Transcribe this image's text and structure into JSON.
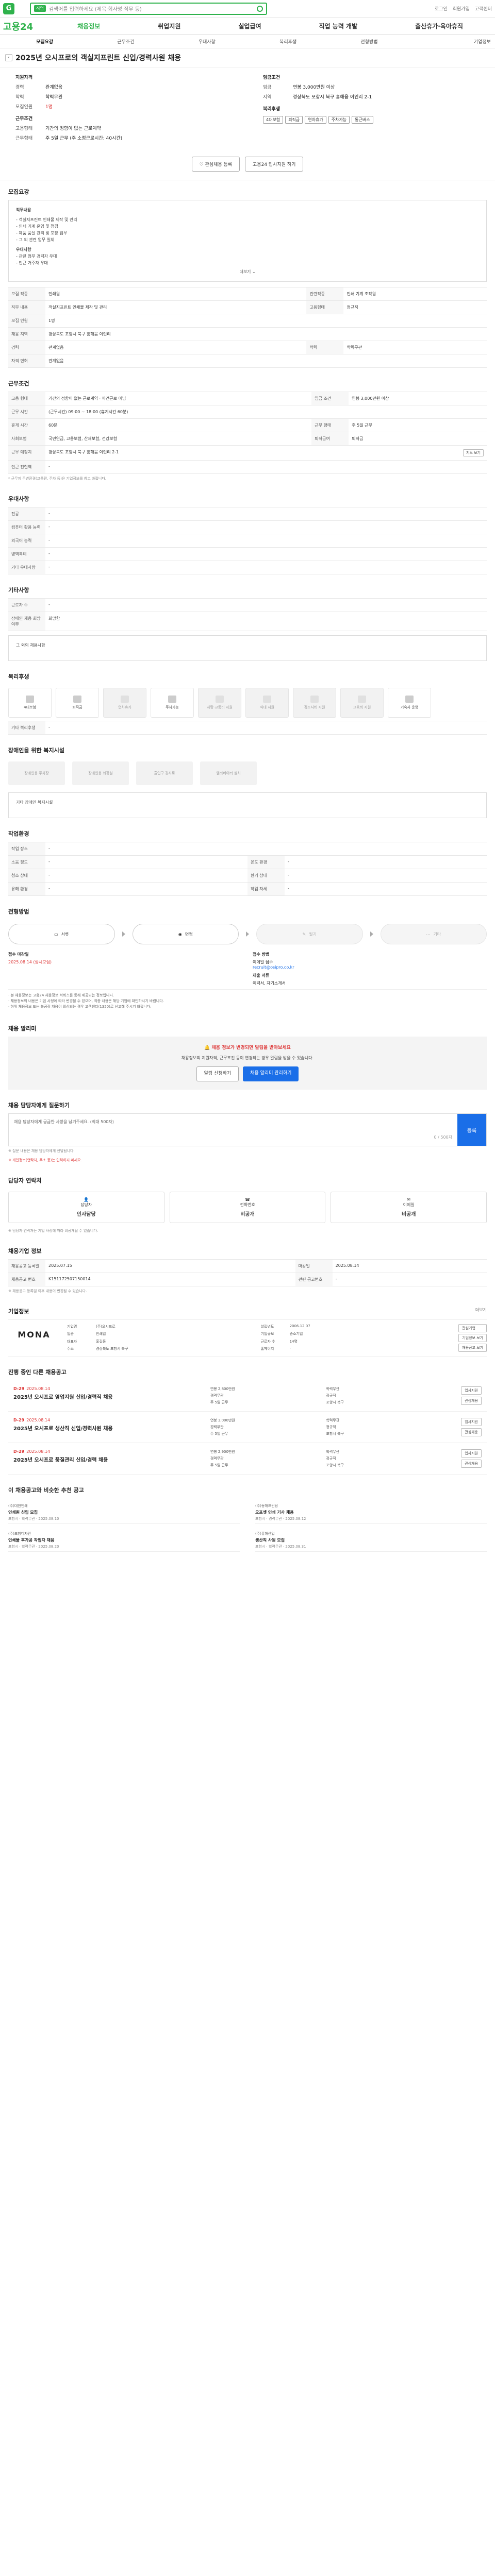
{
  "header": {
    "logo_char": "G",
    "search_mode": "직업",
    "search_placeholder": "검색어를 입력하세요 (제목·회사명·직무 등)",
    "util_links": [
      "로그인",
      "회원가입",
      "고객센터"
    ]
  },
  "gnb": {
    "brand": "고용24",
    "menu": [
      "채용정보",
      "취업지원",
      "실업급여",
      "직업 능력 개발",
      "출산휴가·육아휴직"
    ]
  },
  "tabs": [
    "모집요강",
    "근무조건",
    "우대사항",
    "복리후생",
    "전형방법",
    "기업정보"
  ],
  "page_title": "2025년 오시프로의 객실지프린트 신입/경력사원 채용",
  "summary": {
    "left": {
      "heading": "지원자격",
      "rows": [
        {
          "k": "경력",
          "v": "관계없음"
        },
        {
          "k": "학력",
          "v": "학력무관"
        },
        {
          "k": "모집인원",
          "v": "1명"
        }
      ],
      "heading2": "근무조건",
      "rows2": [
        {
          "k": "고용형태",
          "v": "기간의 정함이 없는 근로계약"
        },
        {
          "k": "근무형태",
          "v": "주 5일 근무 (주 소정근로시간: 40시간)"
        }
      ]
    },
    "right": {
      "heading": "임금조건",
      "rows": [
        {
          "k": "임금",
          "v": "연봉 3,000만원 이상"
        },
        {
          "k": "지역",
          "v": "경상북도 포항시 북구 흥해읍 이인리 2-1"
        }
      ],
      "heading2": "복리후생",
      "chips": [
        "4대보험",
        "퇴직금",
        "연차휴가",
        "주차가능",
        "통근버스"
      ]
    }
  },
  "actions": {
    "bookmark": "관심채용 등록",
    "apply": "고용24 입사지원 하기"
  },
  "sections": {
    "recruit": {
      "title": "모집요강",
      "desc": [
        "직무내용",
        "- 객실지프린트 인쇄물 제작 및 관리",
        "- 인쇄 기계 운영 및 점검",
        "- 제품 품질 관리 및 포장 업무",
        "- 그 외 관련 업무 일체",
        "우대사항",
        "- 관련 업무 경력자 우대",
        "- 인근 거주자 우대"
      ],
      "more": "더보기",
      "table": [
        {
          "k": "모집 직종",
          "v": "인쇄원",
          "k2": "관련직종",
          "v2": "인쇄 기계 조작원"
        },
        {
          "k": "직무 내용",
          "v": "객실지프린트 인쇄물 제작 및 관리",
          "k2": "고용형태",
          "v2": "정규직"
        },
        {
          "k": "모집 인원",
          "v": "1명",
          "k2": "",
          "v2": ""
        },
        {
          "k": "채용 지역",
          "v": "경상북도 포항시 북구 흥해읍 이인리",
          "k2": "",
          "v2": ""
        },
        {
          "k": "경력",
          "v": "관계없음",
          "k2": "학력",
          "v2": "학력무관"
        },
        {
          "k": "자격 면허",
          "v": "관계없음",
          "k2": "",
          "v2": ""
        }
      ]
    },
    "conditions": {
      "title": "근무조건",
      "table": [
        {
          "k": "고용 형태",
          "v": "기간의 정함이 없는 근로계약 · 파견근로 아님",
          "k2": "임금 조건",
          "v2": "연봉 3,000만원 이상"
        },
        {
          "k": "근무 시간",
          "v": "(근무시간) 09:00 ~ 18:00 (휴게시간 60분)",
          "k2": "",
          "v2": ""
        },
        {
          "k": "휴게 시간",
          "v": "60분",
          "k2": "근무 형태",
          "v2": "주 5일 근무"
        },
        {
          "k": "사회보험",
          "v": "국민연금, 고용보험, 산재보험, 건강보험",
          "k2": "퇴직급여",
          "v2": "퇴직금"
        },
        {
          "k": "근무 예정지",
          "v": "경상북도 포항시 북구 흥해읍 이인리 2-1",
          "k2": "",
          "v2": ""
        },
        {
          "k": "인근 전철역",
          "v": "-",
          "k2": "",
          "v2": ""
        }
      ],
      "note": "* 근무지 주변환경(교통편, 주차 등)은 기업정보를 참고 바랍니다.",
      "map_btn": "지도 보기"
    },
    "prefer": {
      "title": "우대사항",
      "table": [
        {
          "k": "전공",
          "v": "-"
        },
        {
          "k": "컴퓨터 활용 능력",
          "v": "-"
        },
        {
          "k": "외국어 능력",
          "v": "-"
        },
        {
          "k": "병역특례",
          "v": "-"
        },
        {
          "k": "기타 우대사항",
          "v": "-"
        }
      ]
    },
    "extra": {
      "title": "기타사항",
      "table": [
        {
          "k": "근로자 수",
          "v": "-"
        },
        {
          "k": "장애인 채용 희망 여부",
          "v": "희망함"
        }
      ],
      "etc": "그 외의 채용사항"
    },
    "welfare": {
      "title": "복리후생",
      "items": [
        {
          "label": "4대보험",
          "dim": false
        },
        {
          "label": "퇴직금",
          "dim": false
        },
        {
          "label": "연차휴가",
          "dim": true
        },
        {
          "label": "주차가능",
          "dim": false
        },
        {
          "label": "차량·교통비 지원",
          "dim": true
        },
        {
          "label": "식대 지원",
          "dim": true
        },
        {
          "label": "경조사비 지원",
          "dim": true
        },
        {
          "label": "교육비 지원",
          "dim": true
        },
        {
          "label": "기숙사 운영",
          "dim": false
        }
      ],
      "etc_label": "기타 복리후생",
      "etc_value": "-"
    },
    "disability": {
      "title": "장애인을 위한 복지시설",
      "items": [
        "장애인용 주차장",
        "장애인용 화장실",
        "출입구 경사로",
        "엘리베이터 설치"
      ],
      "etc": "기타 장애인 복지시설"
    },
    "worktype": {
      "title": "작업환경",
      "table": [
        {
          "k": "작업 장소",
          "v": "-",
          "k2": "",
          "v2": ""
        },
        {
          "k": "소음 정도",
          "v": "-",
          "k2": "온도 환경",
          "v2": "-"
        },
        {
          "k": "청소 상태",
          "v": "-",
          "k2": "환기 상태",
          "v2": "-"
        },
        {
          "k": "유해 환경",
          "v": "-",
          "k2": "작업 자세",
          "v2": "-"
        }
      ]
    },
    "process": {
      "title": "전형방법",
      "steps": [
        {
          "label": "서류",
          "dim": false
        },
        {
          "label": "면접",
          "dim": false
        },
        {
          "label": "필기",
          "dim": true
        },
        {
          "label": "기타",
          "dim": true
        }
      ]
    },
    "apply": {
      "period_label": "접수 마감일",
      "period": "2025.08.14 (상시모집)",
      "method_label": "접수 방법",
      "method": "이메일 접수",
      "email": "recruit@osipro.co.kr",
      "docs_label": "제출 서류",
      "docs": "이력서, 자기소개서",
      "bullets": [
        "· 본 채용정보는 고용24 채용정보 서비스를 통해 제공되는 정보입니다.",
        "· 채용정보의 내용은 기업 사정에 따라 변경될 수 있으며, 최종 내용은 해당 기업에 확인하시기 바랍니다.",
        "· 허위 채용정보 또는 불공정 채용이 의심되는 경우 고객센터(1350)로 신고해 주시기 바랍니다."
      ]
    },
    "report": {
      "title": "채용 알리미",
      "alert_title": "채용 정보가 변경되면 알림을 받아보세요",
      "alert_body": "채용정보의 지원자격, 근무조건 등이 변경되는 경우 알림을 받을 수 있습니다.",
      "alert_btn1": "알림 신청하기",
      "alert_btn2": "채용 알리미 관리하기"
    },
    "inquiry": {
      "title": "채용 담당자에게 질문하기",
      "placeholder": "채용 담당자에게 궁금한 사항을 남겨주세요. (최대 500자)",
      "submit": "등록",
      "counter": "0 / 500자",
      "note1": "※ 질문 내용은 채용 담당자에게 전달됩니다.",
      "note2": "※ 개인정보(연락처, 주소 등)는 입력하지 마세요."
    },
    "contact": {
      "title": "담당자 연락처",
      "cards": [
        {
          "label": "담당자",
          "value": "인사담당"
        },
        {
          "label": "전화번호",
          "value": "비공개"
        },
        {
          "label": "이메일",
          "value": "비공개"
        }
      ],
      "note": "※ 담당자 연락처는 기업 사정에 따라 비공개될 수 있습니다."
    },
    "info": {
      "title": "채용기업 정보",
      "table": [
        {
          "k": "채용공고 등록일",
          "v": "2025.07.15",
          "k2": "마감일",
          "v2": "2025.08.14"
        },
        {
          "k": "채용공고 번호",
          "v": "K151172507150014",
          "k2": "관련 공고번호",
          "v2": "-"
        }
      ],
      "note": "※ 채용공고 등록일 이후 내용이 변경될 수 있습니다."
    },
    "company": {
      "title": "기업정보",
      "more": "더보기",
      "logo": "MONA",
      "fields": [
        {
          "k": "기업명",
          "v": "(주)오시프로"
        },
        {
          "k": "설립년도",
          "v": "2006.12.07"
        },
        {
          "k": "업종",
          "v": "인쇄업"
        },
        {
          "k": "기업규모",
          "v": "중소기업"
        },
        {
          "k": "대표자",
          "v": "홍길동"
        },
        {
          "k": "근로자 수",
          "v": "14명"
        },
        {
          "k": "주소",
          "v": "경상북도 포항시 북구"
        },
        {
          "k": "홈페이지",
          "v": "-"
        }
      ],
      "btns": [
        "관심기업",
        "기업정보 보기",
        "채용공고 보기"
      ]
    },
    "jobs": {
      "title": "진행 중인 다른 채용공고",
      "items": [
        {
          "dday": "D-29",
          "date": "2025.08.14",
          "title": "2025년 오시프로 영업지원 신입/경력직 채용",
          "meta": [
            "연봉 2,800만원",
            "학력무관",
            "경력무관",
            "정규직",
            "주 5일 근무",
            "포항시 북구"
          ],
          "btns": [
            "입사지원",
            "관심채용"
          ]
        },
        {
          "dday": "D-29",
          "date": "2025.08.14",
          "title": "2025년 오시프로 생산직 신입/경력사원 채용",
          "meta": [
            "연봉 3,000만원",
            "학력무관",
            "경력무관",
            "정규직",
            "주 5일 근무",
            "포항시 북구"
          ],
          "btns": [
            "입사지원",
            "관심채용"
          ]
        },
        {
          "dday": "D-29",
          "date": "2025.08.14",
          "title": "2025년 오시프로 품질관리 신입/경력 채용",
          "meta": [
            "연봉 2,900만원",
            "학력무관",
            "경력무관",
            "정규직",
            "주 5일 근무",
            "포항시 북구"
          ],
          "btns": [
            "입사지원",
            "관심채용"
          ]
        }
      ]
    },
    "recommend": {
      "title": "이 채용공고와 비슷한 추천 공고",
      "items": [
        {
          "co": "(주)대한인쇄",
          "title": "인쇄원 신입 모집",
          "meta": "포항시 · 학력무관 · 2025.08.10"
        },
        {
          "co": "(주)동해프린팅",
          "title": "오프셋 인쇄 기사 채용",
          "meta": "포항시 · 경력무관 · 2025.08.12"
        },
        {
          "co": "(주)포항디자인",
          "title": "인쇄물 후가공 작업자 채용",
          "meta": "포항시 · 학력무관 · 2025.08.20"
        },
        {
          "co": "(주)흥해산업",
          "title": "생산직 사원 모집",
          "meta": "포항시 · 학력무관 · 2025.08.31"
        }
      ]
    }
  }
}
